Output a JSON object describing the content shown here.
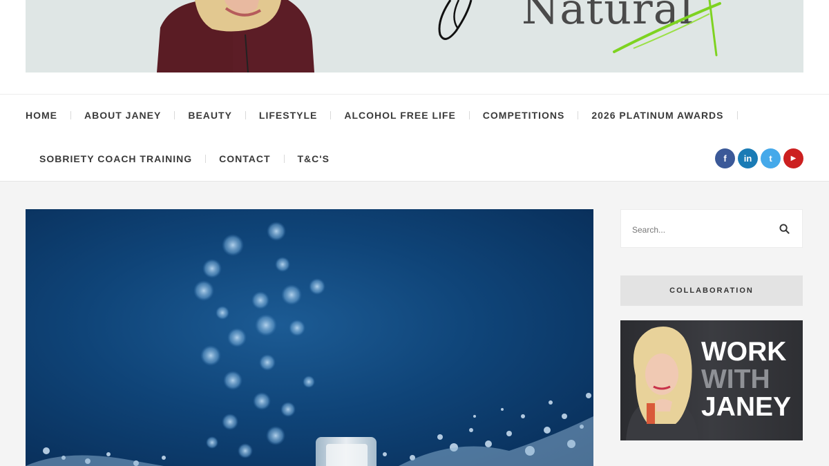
{
  "header": {
    "logo_text": "Natural"
  },
  "nav": {
    "row1": [
      "HOME",
      "ABOUT JANEY",
      "BEAUTY",
      "LIFESTYLE",
      "ALCOHOL FREE LIFE",
      "COMPETITIONS",
      "2026 PLATINUM AWARDS"
    ],
    "row2": [
      "SOBRIETY COACH TRAINING",
      "CONTACT",
      "T&C'S"
    ]
  },
  "social": [
    {
      "icon": "facebook-icon",
      "glyph": "f",
      "color": "#3b5998"
    },
    {
      "icon": "linkedin-icon",
      "glyph": "in",
      "color": "#1a7bb5"
    },
    {
      "icon": "twitter-icon",
      "glyph": "t",
      "color": "#45a9ea"
    },
    {
      "icon": "youtube-icon",
      "glyph": "▶",
      "color": "#cc2020"
    }
  ],
  "sidebar": {
    "search_placeholder": "Search...",
    "widget_title": "COLLABORATION",
    "promo": {
      "line1": "WORK",
      "line2": "WITH",
      "line3": "JANEY",
      "line1_color": "#ffffff",
      "line2_color": "#8f9196",
      "line3_color": "#ffffff"
    }
  },
  "colors": {
    "accent_green": "#7ed321",
    "hero_blue": "#0f4478"
  }
}
